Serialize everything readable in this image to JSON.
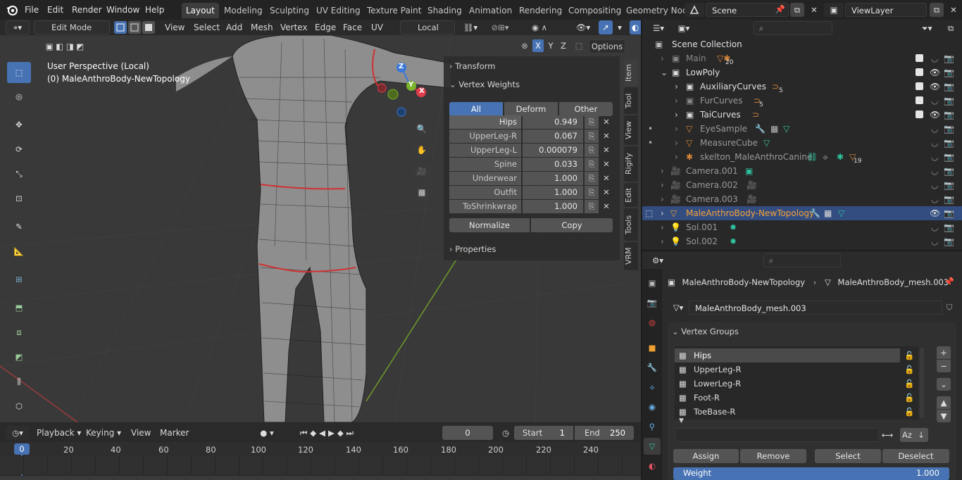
{
  "menu": [
    "File",
    "Edit",
    "Render",
    "Window",
    "Help"
  ],
  "workspaces": [
    "Layout",
    "Modeling",
    "Sculpting",
    "UV Editing",
    "Texture Paint",
    "Shading",
    "Animation",
    "Rendering",
    "Compositing",
    "Geometry Noc"
  ],
  "scene": "Scene",
  "view_layer": "ViewLayer",
  "viewport_header": {
    "mode": "Edit Mode",
    "menus": [
      "View",
      "Select",
      "Add",
      "Mesh",
      "Vertex",
      "Edge",
      "Face",
      "UV"
    ],
    "orientation": "Local",
    "axes": [
      "X",
      "Y",
      "Z"
    ],
    "options": "Options"
  },
  "viewport_overlay": {
    "perspective": "User Perspective (Local)",
    "object": "(0) MaleAnthroBody-NewTopology",
    "gizmo_axes": [
      "Z",
      "Y",
      "X"
    ]
  },
  "npanel": {
    "transform": "Transform",
    "vertex_weights": "Vertex Weights",
    "filters": [
      "All",
      "Deform",
      "Other"
    ],
    "weights": [
      {
        "name": "Hips",
        "value": "0.949"
      },
      {
        "name": "UpperLeg-R",
        "value": "0.067"
      },
      {
        "name": "UpperLeg-L",
        "value": "0.000079"
      },
      {
        "name": "Spine",
        "value": "0.033"
      },
      {
        "name": "Underwear",
        "value": "1.000"
      },
      {
        "name": "Outfit",
        "value": "1.000"
      },
      {
        "name": "ToShrinkwrap",
        "value": "1.000"
      }
    ],
    "normalize": "Normalize",
    "copy": "Copy",
    "properties": "Properties",
    "tabs": [
      "Item",
      "Tool",
      "View",
      "Rigify",
      "Edit",
      "Tools",
      "VRM"
    ]
  },
  "outliner": {
    "root": "Scene Collection",
    "items": [
      {
        "name": "Main",
        "badge": "20",
        "check": true,
        "dim": true
      },
      {
        "name": "LowPoly",
        "badge": "",
        "check": true,
        "dim": false
      },
      {
        "name": "AuxiliaryCurves",
        "badge": "5",
        "check": true,
        "dim": false
      },
      {
        "name": "FurCurves",
        "badge": "5",
        "check": true,
        "dim": true
      },
      {
        "name": "TaiCurves",
        "badge": "",
        "check": true,
        "dim": false
      },
      {
        "name": "EyeSample",
        "badge": "",
        "check": false,
        "dim": true
      },
      {
        "name": "MeasureCube",
        "badge": "",
        "check": false,
        "dim": true
      },
      {
        "name": "skelton_MaleAnthroCanine",
        "badge": "19",
        "check": false,
        "dim": true
      },
      {
        "name": "Camera.001",
        "badge": "",
        "check": false,
        "dim": true
      },
      {
        "name": "Camera.002",
        "badge": "",
        "check": false,
        "dim": true
      },
      {
        "name": "Camera.003",
        "badge": "",
        "check": false,
        "dim": true
      },
      {
        "name": "MaleAnthroBody-NewTopology",
        "badge": "",
        "check": false,
        "dim": false
      },
      {
        "name": "Sol.001",
        "badge": "",
        "check": false,
        "dim": true
      },
      {
        "name": "Sol.002",
        "badge": "",
        "check": false,
        "dim": true
      }
    ]
  },
  "properties": {
    "object": "MaleAnthroBody-NewTopology",
    "mesh": "MaleAnthroBody_mesh.003",
    "mesh_field": "MaleAnthroBody_mesh.003",
    "panel": "Vertex Groups",
    "groups": [
      "Hips",
      "UpperLeg-R",
      "LowerLeg-R",
      "Foot-R",
      "ToeBase-R"
    ],
    "assign": "Assign",
    "remove": "Remove",
    "select": "Select",
    "deselect": "Deselect",
    "weight_label": "Weight",
    "weight_value": "1.000"
  },
  "timeline": {
    "playback": "Playback",
    "keying": "Keying",
    "view": "View",
    "marker": "Marker",
    "current": "0",
    "start_label": "Start",
    "start": "1",
    "end_label": "End",
    "end": "250",
    "ticks": [
      "0",
      "20",
      "40",
      "60",
      "80",
      "100",
      "120",
      "140",
      "160",
      "180",
      "200",
      "220",
      "240"
    ]
  }
}
